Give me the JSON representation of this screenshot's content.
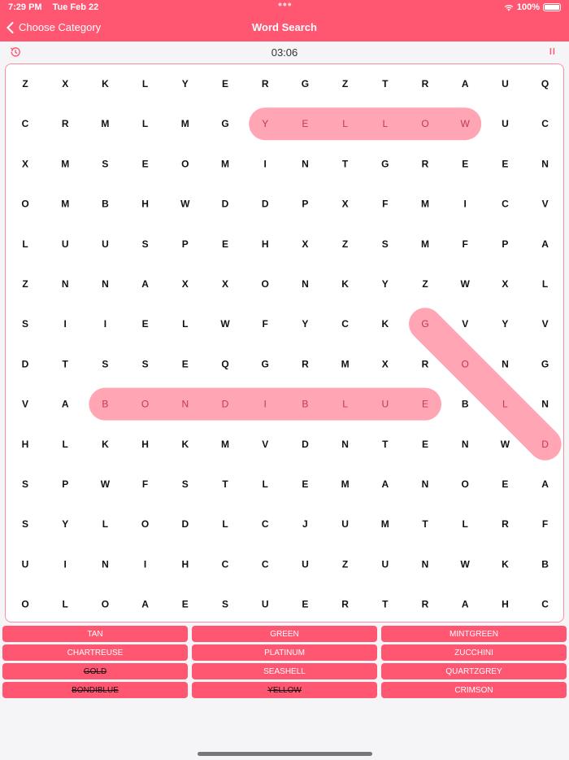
{
  "status": {
    "time": "7:29 PM",
    "date": "Tue Feb 22",
    "battery": "100%"
  },
  "nav": {
    "back_label": "Choose Category",
    "title": "Word Search"
  },
  "timer": "03:06",
  "grid": [
    [
      "Z",
      "X",
      "K",
      "L",
      "Y",
      "E",
      "R",
      "G",
      "Z",
      "T",
      "R",
      "A",
      "U",
      "Q"
    ],
    [
      "C",
      "R",
      "M",
      "L",
      "M",
      "G",
      "Y",
      "E",
      "L",
      "L",
      "O",
      "W",
      "U",
      "C"
    ],
    [
      "X",
      "M",
      "S",
      "E",
      "O",
      "M",
      "I",
      "N",
      "T",
      "G",
      "R",
      "E",
      "E",
      "N"
    ],
    [
      "O",
      "M",
      "B",
      "H",
      "W",
      "D",
      "D",
      "P",
      "X",
      "F",
      "M",
      "I",
      "C",
      "V"
    ],
    [
      "L",
      "U",
      "U",
      "S",
      "P",
      "E",
      "H",
      "X",
      "Z",
      "S",
      "M",
      "F",
      "P",
      "A"
    ],
    [
      "Z",
      "N",
      "N",
      "A",
      "X",
      "X",
      "O",
      "N",
      "K",
      "Y",
      "Z",
      "W",
      "X",
      "L"
    ],
    [
      "S",
      "I",
      "I",
      "E",
      "L",
      "W",
      "F",
      "Y",
      "C",
      "K",
      "G",
      "V",
      "Y",
      "V"
    ],
    [
      "D",
      "T",
      "S",
      "S",
      "E",
      "Q",
      "G",
      "R",
      "M",
      "X",
      "R",
      "O",
      "N",
      "G"
    ],
    [
      "V",
      "A",
      "B",
      "O",
      "N",
      "D",
      "I",
      "B",
      "L",
      "U",
      "E",
      "B",
      "L",
      "N"
    ],
    [
      "H",
      "L",
      "K",
      "H",
      "K",
      "M",
      "V",
      "D",
      "N",
      "T",
      "E",
      "N",
      "W",
      "D"
    ],
    [
      "S",
      "P",
      "W",
      "F",
      "S",
      "T",
      "L",
      "E",
      "M",
      "A",
      "N",
      "O",
      "E",
      "A"
    ],
    [
      "S",
      "Y",
      "L",
      "O",
      "D",
      "L",
      "C",
      "J",
      "U",
      "M",
      "T",
      "L",
      "R",
      "F"
    ],
    [
      "U",
      "I",
      "N",
      "I",
      "H",
      "C",
      "C",
      "U",
      "Z",
      "U",
      "N",
      "W",
      "K",
      "B"
    ],
    [
      "O",
      "L",
      "O",
      "A",
      "E",
      "S",
      "U",
      "E",
      "R",
      "T",
      "R",
      "A",
      "H",
      "C"
    ]
  ],
  "found_highlights": [
    {
      "word": "YELLOW",
      "start": [
        1,
        6
      ],
      "end": [
        1,
        11
      ]
    },
    {
      "word": "BONDIBLUE",
      "start": [
        8,
        2
      ],
      "end": [
        8,
        10
      ]
    },
    {
      "word": "GOLD",
      "start": [
        6,
        10
      ],
      "end": [
        9,
        13
      ]
    }
  ],
  "words": [
    {
      "label": "TAN",
      "found": false
    },
    {
      "label": "GREEN",
      "found": false
    },
    {
      "label": "MINTGREEN",
      "found": false
    },
    {
      "label": "CHARTREUSE",
      "found": false
    },
    {
      "label": "PLATINUM",
      "found": false
    },
    {
      "label": "ZUCCHINI",
      "found": false
    },
    {
      "label": "GOLD",
      "found": true
    },
    {
      "label": "SEASHELL",
      "found": false
    },
    {
      "label": "QUARTZGREY",
      "found": false
    },
    {
      "label": "BONDIBLUE",
      "found": true
    },
    {
      "label": "YELLOW",
      "found": true
    },
    {
      "label": "CRIMSON",
      "found": false
    }
  ],
  "colors": {
    "accent": "#ff5672",
    "highlight": "#ffa5b3",
    "found_letter": "#c03a52"
  },
  "icons": {
    "back": "chevron-left-icon",
    "history": "history-icon",
    "pause": "pause-icon",
    "wifi": "wifi-icon",
    "battery": "battery-icon"
  }
}
